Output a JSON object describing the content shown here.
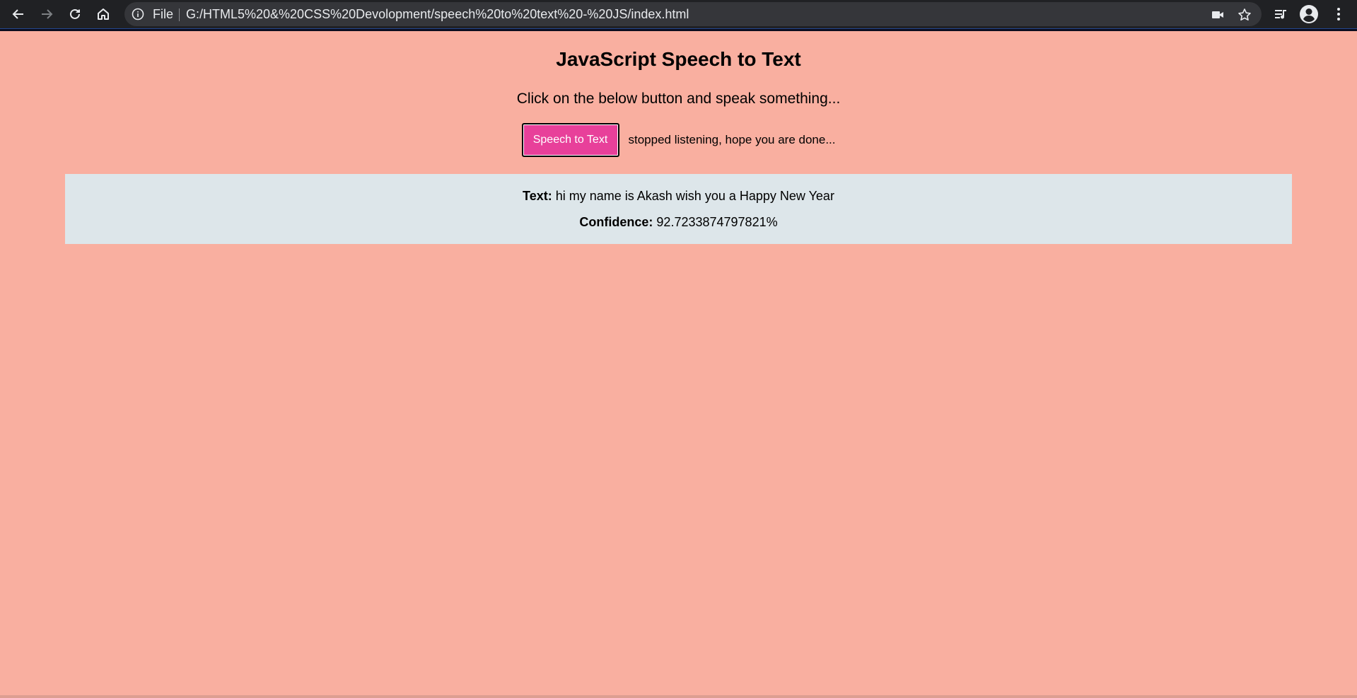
{
  "browser": {
    "url_scheme": "File",
    "url": "G:/HTML5%20&%20CSS%20Devolopment/speech%20to%20text%20-%20JS/index.html",
    "icons": {
      "back": "arrow-left-icon",
      "forward": "arrow-right-icon",
      "reload": "reload-icon",
      "home": "home-icon",
      "info": "info-icon",
      "camera": "camera-icon",
      "bookmark": "star-icon",
      "media": "media-control-icon",
      "profile": "account-icon",
      "menu": "kebab-menu-icon"
    }
  },
  "page": {
    "title": "JavaScript Speech to Text",
    "subtitle": "Click on the below button and speak something...",
    "button_label": "Speech to Text",
    "status": "stopped listening, hope you are done...",
    "result": {
      "text_label": "Text:",
      "text_value": "hi my name is Akash wish you a Happy New Year",
      "confidence_label": "Confidence:",
      "confidence_value": "92.7233874797821%"
    }
  },
  "colors": {
    "page_background": "#f9afa0",
    "button_background": "#e8409a",
    "result_background": "#dde6ea",
    "toolbar_background": "#202124",
    "omnibox_background": "#35363a"
  }
}
